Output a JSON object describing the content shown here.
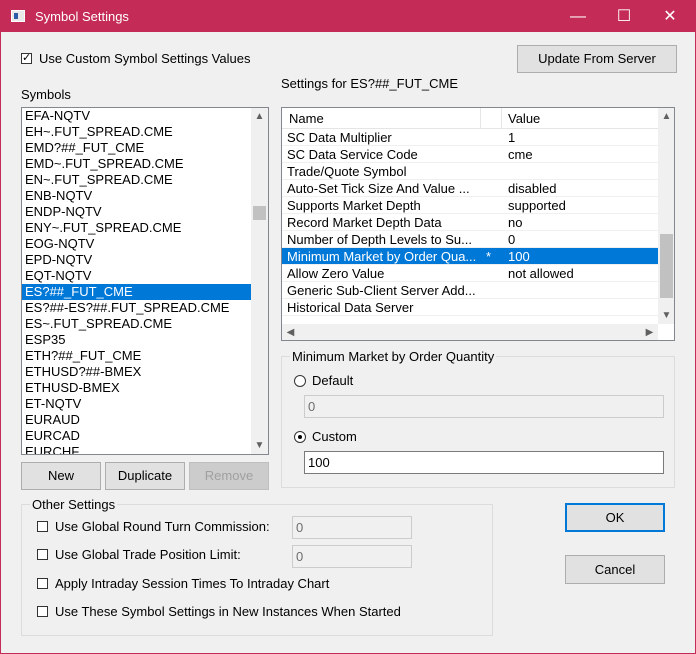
{
  "window": {
    "title": "Symbol Settings",
    "minimize": "—",
    "maximize": "☐",
    "close": "✕"
  },
  "top": {
    "use_custom_label": "Use Custom Symbol Settings Values",
    "use_custom_checked": "✓",
    "update_button": "Update From Server"
  },
  "symbols": {
    "label": "Symbols",
    "items": [
      "EFA-NQTV",
      "EH~.FUT_SPREAD.CME",
      "EMD?##_FUT_CME",
      "EMD~.FUT_SPREAD.CME",
      "EN~.FUT_SPREAD.CME",
      "ENB-NQTV",
      "ENDP-NQTV",
      "ENY~.FUT_SPREAD.CME",
      "EOG-NQTV",
      "EPD-NQTV",
      "EQT-NQTV",
      "ES?##_FUT_CME",
      "ES?##-ES?##.FUT_SPREAD.CME",
      "ES~.FUT_SPREAD.CME",
      "ESP35",
      "ETH?##_FUT_CME",
      "ETHUSD?##-BMEX",
      "ETHUSD-BMEX",
      "ET-NQTV",
      "EURAUD",
      "EURCAD",
      "EURCHF"
    ],
    "selected": "ES?##_FUT_CME",
    "new_button": "New",
    "duplicate_button": "Duplicate",
    "remove_button": "Remove"
  },
  "settings": {
    "label": "Settings for ES?##_FUT_CME",
    "col_name": "Name",
    "col_value": "Value",
    "rows": [
      {
        "name": "SC Data Multiplier",
        "mark": "",
        "value": "1"
      },
      {
        "name": "SC Data Service Code",
        "mark": "",
        "value": "cme"
      },
      {
        "name": "Trade/Quote Symbol",
        "mark": "",
        "value": ""
      },
      {
        "name": "Auto-Set Tick Size And Value ...",
        "mark": "",
        "value": "disabled"
      },
      {
        "name": "Supports Market Depth",
        "mark": "",
        "value": "supported"
      },
      {
        "name": "Record Market Depth Data",
        "mark": "",
        "value": "no"
      },
      {
        "name": "Number of Depth Levels to Su...",
        "mark": "",
        "value": "0"
      },
      {
        "name": "Minimum Market by Order Qua...",
        "mark": "*",
        "value": "100"
      },
      {
        "name": "Allow Zero Value",
        "mark": "",
        "value": "not allowed"
      },
      {
        "name": "Generic Sub-Client Server Add...",
        "mark": "",
        "value": ""
      },
      {
        "name": "Historical Data Server",
        "mark": "",
        "value": ""
      }
    ],
    "selected_row": "Minimum Market by Order Qua..."
  },
  "detail": {
    "legend": "Minimum Market by Order Quantity",
    "default_label": "Default",
    "default_value": "0",
    "custom_label": "Custom",
    "custom_value": "100"
  },
  "other": {
    "legend": "Other Settings",
    "global_commission_label": "Use Global Round Turn Commission:",
    "global_commission_value": "0",
    "global_position_label": "Use Global Trade Position Limit:",
    "global_position_value": "0",
    "intraday_label": "Apply Intraday Session Times To Intraday Chart",
    "new_instances_label": "Use These Symbol Settings in New Instances When Started"
  },
  "dialog": {
    "ok_button": "OK",
    "cancel_button": "Cancel"
  },
  "colors": {
    "titlebar": "#c42b56",
    "selection": "#0078d7"
  }
}
